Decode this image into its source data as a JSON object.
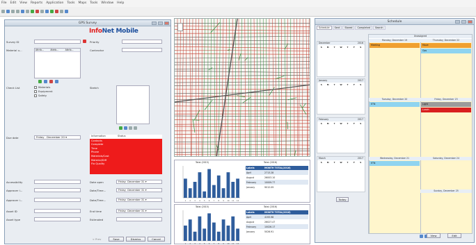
{
  "menubar": [
    "File",
    "Edit",
    "View",
    "Reports",
    "Application",
    "Tools",
    "Maps",
    "Tools",
    "Window",
    "Help"
  ],
  "gps": {
    "title": "GPS Survey",
    "logo_info": "Info",
    "logo_net": "Net Mobile",
    "survey_id_label": "Survey ID",
    "priority_label": "Priority",
    "material_label": "Material u...",
    "contractor_label": "Contractor",
    "table_headers": [
      "Attrib...",
      "Attrib...",
      "Attrib..."
    ],
    "check_list_label": "Check List",
    "checks": [
      "Materials",
      "Equipment",
      "Safety"
    ],
    "sketch_label": "Sketch",
    "due_date_label": "Due date",
    "due_day": "Friday",
    "due_date": "December 20",
    "info_headers": [
      "Information",
      "Status"
    ],
    "info_items": [
      "Contacts",
      "Complete",
      "Time",
      "Phone",
      "Materials/Cost",
      "Material/Diff",
      "Flo Quality"
    ],
    "accessibility_label": "Accessibility",
    "date_open_label": "Date open",
    "date_open_day": "Friday",
    "date_open_date": "December 31",
    "approver_label": "Approver i...",
    "datetime1_label": "Date/Time...",
    "datetime1_day": "Friday",
    "datetime1_date": "December 31",
    "approver2_label": "Approver i...",
    "datetime2_label": "Date/Time...",
    "datetime2_day": "Friday",
    "datetime2_date": "December 31",
    "asset_id_label": "Asset ID",
    "end_time_label": "End time",
    "end_time_day": "Friday",
    "end_time_date": "December 31",
    "asset_type_label": "Asset type",
    "estimated_label": "Estimated",
    "buttons": [
      "< Prev",
      "Save",
      "Dismiss",
      "Cancel"
    ]
  },
  "charts": [
    {
      "title": "Total (2015)",
      "table_title": "Total (2016)"
    },
    {
      "title": "Total (2015)",
      "table_title": "Total (2016)"
    }
  ],
  "chart_data": [
    {
      "type": "bar",
      "title": "Total (2015)",
      "categories": [
        "1",
        "2",
        "3",
        "4",
        "5",
        "6",
        "7",
        "8",
        "9",
        "10",
        "11",
        "12"
      ],
      "values": [
        6,
        3,
        5,
        8,
        2,
        9,
        4,
        7,
        3,
        8,
        5,
        6
      ],
      "ylim": [
        0,
        10
      ]
    },
    {
      "type": "bar",
      "title": "Total (2015)",
      "categories": [
        "1",
        "2",
        "3",
        "4",
        "5",
        "6",
        "7",
        "8",
        "9",
        "10",
        "11",
        "12"
      ],
      "values": [
        5,
        7,
        3,
        8,
        4,
        9,
        6,
        3,
        7,
        5,
        8,
        4
      ],
      "ylim": [
        0,
        10
      ]
    }
  ],
  "tables": [
    {
      "headers": [
        "Labels",
        "MONTH TOTAL(2016)"
      ],
      "rows": [
        [
          "April",
          "2713.28"
        ],
        [
          "August",
          "26003.10"
        ],
        [
          "February",
          "10009.77"
        ],
        [
          "January",
          "9012.09"
        ]
      ]
    },
    {
      "headers": [
        "Labels",
        "MONTH TOTAL(2016)"
      ],
      "rows": [
        [
          "April",
          "4193.98"
        ],
        [
          "August",
          "26027.47"
        ],
        [
          "February",
          "10026.17"
        ],
        [
          "January",
          "5026.91"
        ]
      ]
    }
  ],
  "schedule": {
    "title": "Schedule",
    "tabs": [
      "Schedule",
      "Sent",
      "Stored",
      "Completed",
      "Search"
    ],
    "unassigned_label": "Unassigned",
    "mini_months": [
      {
        "name": "December",
        "year": "2016"
      },
      {
        "name": "January",
        "year": "2017"
      },
      {
        "name": "February",
        "year": "2017"
      },
      {
        "name": "March",
        "year": "2017"
      }
    ],
    "weekdays": [
      "S",
      "M",
      "T",
      "W",
      "T",
      "F",
      "S"
    ],
    "day_headers": [
      "Monday, December 19",
      "Thursday, December 22",
      "Tuesday, December 20",
      "Friday, December 23",
      "Wednesday, December 21",
      "Saturday, December 24",
      "Sunday, December 25"
    ],
    "events": [
      "Meeting",
      "Move",
      "Ops",
      "ETN",
      "Light",
      "Lunch",
      "ETN"
    ],
    "today_label": "Today",
    "view_button": "View",
    "edit_button": "Edit"
  },
  "colors": {
    "accent_red": "#ee1b1b",
    "event_orange": "#f0a030",
    "event_blue": "#8fd4f0",
    "day_yellow": "#fff6cc"
  }
}
